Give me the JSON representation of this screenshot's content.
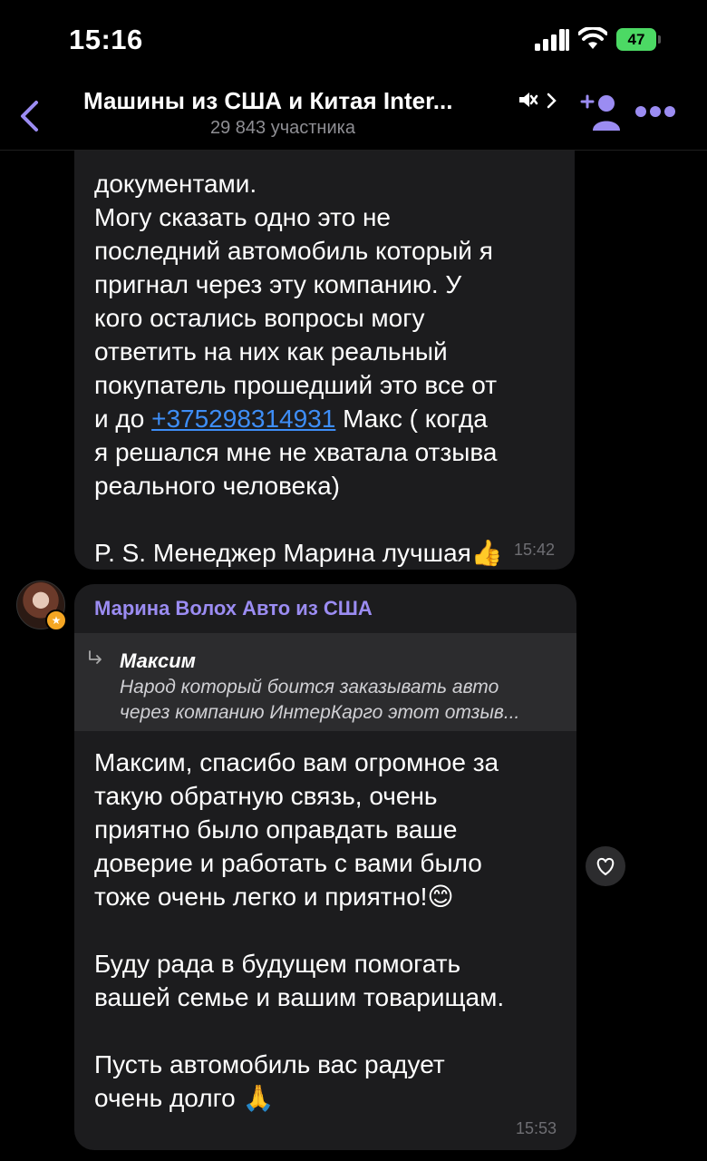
{
  "status_bar": {
    "time": "15:16",
    "battery": "47"
  },
  "header": {
    "title": "Машины из США и Китая Inter...",
    "subtitle": "29 843 участника"
  },
  "messages": [
    {
      "text_before_link": "документами.\nМогу сказать одно это не\nпоследний автомобиль который я\nпригнал через эту компанию. У\nкого остались вопросы могу\nответить на них как реальный\nпокупатель прошедший это все от\nи до ",
      "link": "+375298314931",
      "text_after_link": " Макс ( когда\nя решался мне не хватала отзыва\nреального человека)\n\nP. S. Менеджер Марина лучшая👍",
      "time": "15:42"
    },
    {
      "sender": "Марина Волох Авто из США",
      "reply_to": {
        "name": "Максим",
        "text": "Народ который боится заказывать авто\nчерез компанию ИнтерКарго этот отзыв..."
      },
      "text": "Максим, спасибо вам огромное за\nтакую обратную связь, очень\nприятно было оправдать ваше\nдоверие и работать с вами было\nтоже очень легко и приятно!😊\n\nБуду рада в будущем помогать\nвашей семье и вашим товарищам.\n\nПусть автомобиль вас радует\nочень долго 🙏",
      "time": "15:53"
    }
  ],
  "colors": {
    "accent": "#9b8cf2",
    "link": "#3e8ef7",
    "bubble": "#1c1c1e"
  }
}
